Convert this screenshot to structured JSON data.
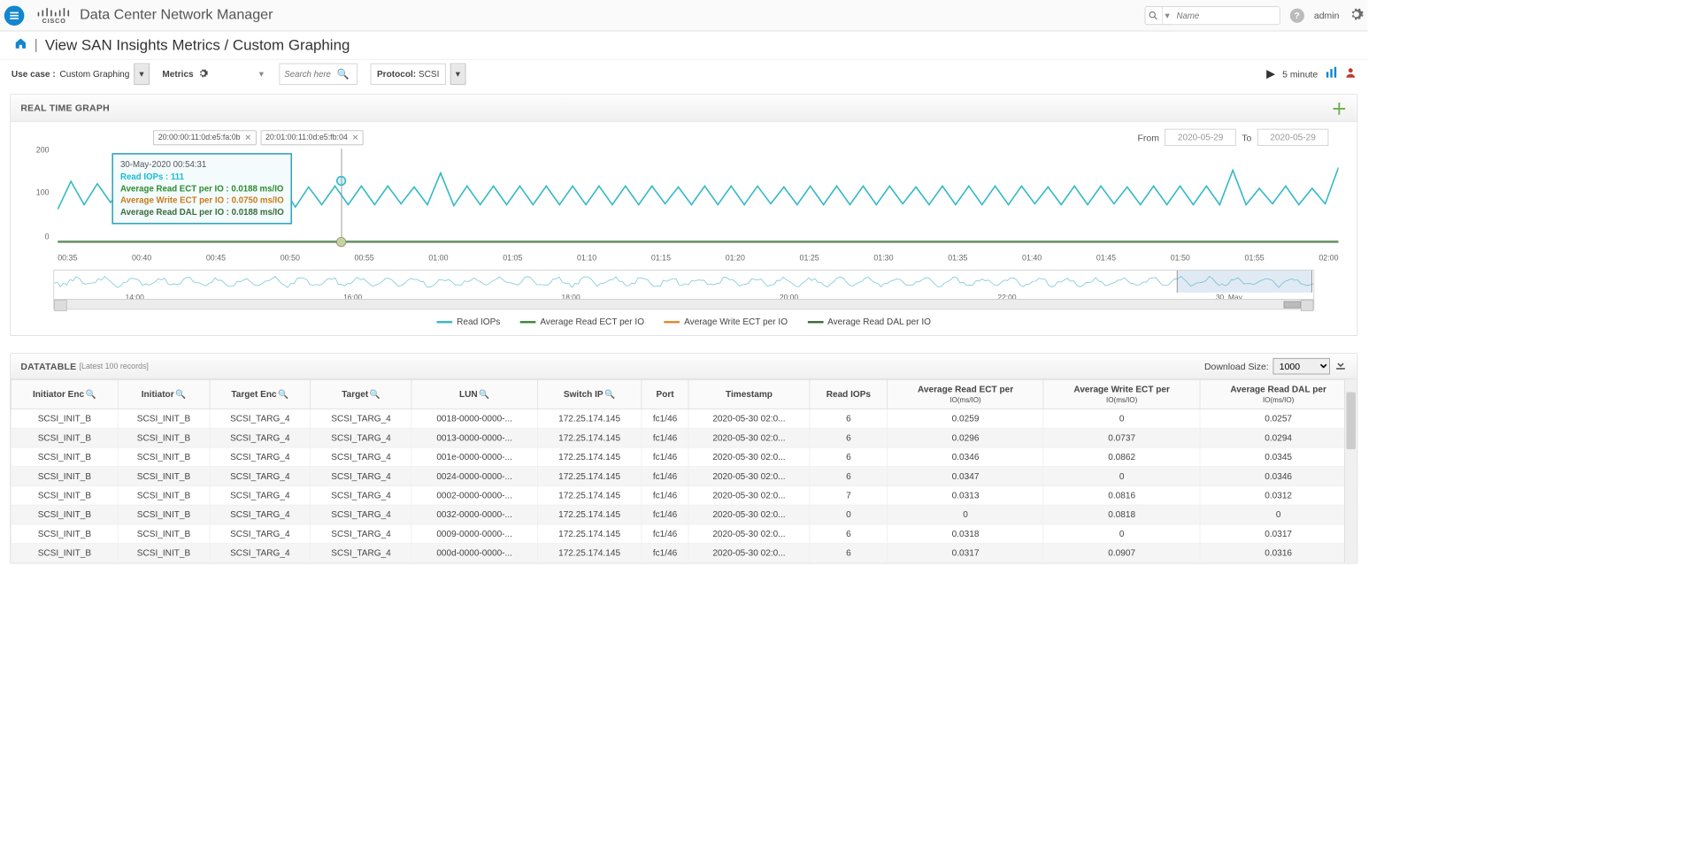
{
  "app_title": "Data Center Network Manager",
  "header": {
    "search_placeholder": "Name",
    "user": "admin"
  },
  "breadcrumb": {
    "path": "View SAN Insights Metrics / Custom Graphing"
  },
  "toolbar": {
    "usecase_label": "Use case :",
    "usecase_value": "Custom Graphing",
    "metrics_label": "Metrics",
    "search_placeholder": "Search here",
    "protocol_label": "Protocol:",
    "protocol_value": "SCSI",
    "refresh": "5 minute"
  },
  "graph_panel": {
    "title": "REAL TIME GRAPH",
    "chips": [
      "20:00:00:11:0d:e5:fa:0b",
      "20:01:00:11:0d:e5:fb:04"
    ],
    "from_label": "From",
    "to_label": "To",
    "from_date": "2020-05-29",
    "to_date": "2020-05-29",
    "tooltip": {
      "time": "30-May-2020 00:54:31",
      "l1_label": "Read IOPs :",
      "l1_val": "111",
      "l2_label": "Average Read ECT per IO :",
      "l2_val": "0.0188 ms/IO",
      "l3_label": "Average Write ECT per IO :",
      "l3_val": "0.0750 ms/IO",
      "l4_label": "Average Read DAL per IO :",
      "l4_val": "0.0188 ms/IO"
    },
    "legend": [
      "Read IOPs",
      "Average Read ECT per IO",
      "Average Write ECT per IO",
      "Average Read DAL per IO"
    ],
    "legend_colors": [
      "#35b9c7",
      "#3a8a3a",
      "#e08a2a",
      "#3a6b3a"
    ]
  },
  "chart_data": {
    "type": "line",
    "title": "REAL TIME GRAPH",
    "xlabel": "",
    "ylabel": "",
    "ylim": [
      0,
      200
    ],
    "y_ticks": [
      0,
      100,
      200
    ],
    "x_ticks": [
      "00:35",
      "00:40",
      "00:45",
      "00:50",
      "00:55",
      "01:00",
      "01:05",
      "01:10",
      "01:15",
      "01:20",
      "01:25",
      "01:30",
      "01:35",
      "01:40",
      "01:45",
      "01:50",
      "01:55",
      "02:00"
    ],
    "series": [
      {
        "name": "Read IOPs",
        "color": "#35b9c7",
        "values": [
          70,
          130,
          80,
          125,
          85,
          120,
          80,
          125,
          75,
          120,
          80,
          125,
          75,
          115,
          78,
          118,
          80,
          120,
          75,
          118,
          80,
          120,
          80,
          120,
          80,
          120,
          82,
          118,
          80,
          148,
          78,
          120,
          80,
          120,
          80,
          120,
          80,
          120,
          80,
          120,
          80,
          120,
          80,
          120,
          80,
          120,
          82,
          118,
          80,
          120,
          80,
          120,
          80,
          120,
          82,
          118,
          80,
          120,
          80,
          120,
          80,
          120,
          80,
          120,
          82,
          118,
          80,
          120,
          80,
          120,
          80,
          120,
          80,
          120,
          82,
          118,
          80,
          120,
          80,
          120,
          82,
          118,
          80,
          120,
          80,
          120,
          80,
          120,
          80,
          154,
          80,
          115,
          82,
          120,
          80,
          115,
          82,
          160
        ]
      },
      {
        "name": "Average Read ECT per IO",
        "color": "#3a8a3a",
        "values": [
          0.019,
          0.018,
          0.02,
          0.019,
          0.018,
          0.019
        ]
      },
      {
        "name": "Average Write ECT per IO",
        "color": "#e08a2a",
        "values": [
          0.075,
          0.07,
          0.08,
          0.076,
          0.074,
          0.078
        ]
      },
      {
        "name": "Average Read DAL per IO",
        "color": "#3a6b3a",
        "values": [
          0.019,
          0.018,
          0.02,
          0.019,
          0.018,
          0.019
        ]
      }
    ],
    "navigator_x_ticks": [
      "14:00",
      "16:00",
      "18:00",
      "20:00",
      "22:00",
      "30. May"
    ]
  },
  "datatable": {
    "title": "DATATABLE",
    "subtitle": "[Latest 100 records]",
    "download_label": "Download Size:",
    "download_value": "1000",
    "columns": [
      "Initiator Enc",
      "Initiator",
      "Target Enc",
      "Target",
      "LUN",
      "Switch IP",
      "Port",
      "Timestamp",
      "Read IOPs",
      "Average Read ECT per IO(ms/IO)",
      "Average Write ECT per IO(ms/IO)",
      "Average Read DAL per IO(ms/IO)"
    ],
    "col_top": [
      "Initiator Enc",
      "Initiator",
      "Target Enc",
      "Target",
      "LUN",
      "Switch IP",
      "Port",
      "Timestamp",
      "Read IOPs",
      "Average Read ECT per",
      "Average Write ECT per",
      "Average Read DAL per"
    ],
    "col_sub": [
      "",
      "",
      "",
      "",
      "",
      "",
      "",
      "",
      "",
      "IO(ms/IO)",
      "IO(ms/IO)",
      "IO(ms/IO)"
    ],
    "rows": [
      [
        "SCSI_INIT_B",
        "SCSI_INIT_B",
        "SCSI_TARG_4",
        "SCSI_TARG_4",
        "0018-0000-0000-...",
        "172.25.174.145",
        "fc1/46",
        "2020-05-30 02:0...",
        "6",
        "0.0259",
        "0",
        "0.0257"
      ],
      [
        "SCSI_INIT_B",
        "SCSI_INIT_B",
        "SCSI_TARG_4",
        "SCSI_TARG_4",
        "0013-0000-0000-...",
        "172.25.174.145",
        "fc1/46",
        "2020-05-30 02:0...",
        "6",
        "0.0296",
        "0.0737",
        "0.0294"
      ],
      [
        "SCSI_INIT_B",
        "SCSI_INIT_B",
        "SCSI_TARG_4",
        "SCSI_TARG_4",
        "001e-0000-0000-...",
        "172.25.174.145",
        "fc1/46",
        "2020-05-30 02:0...",
        "6",
        "0.0346",
        "0.0862",
        "0.0345"
      ],
      [
        "SCSI_INIT_B",
        "SCSI_INIT_B",
        "SCSI_TARG_4",
        "SCSI_TARG_4",
        "0024-0000-0000-...",
        "172.25.174.145",
        "fc1/46",
        "2020-05-30 02:0...",
        "6",
        "0.0347",
        "0",
        "0.0346"
      ],
      [
        "SCSI_INIT_B",
        "SCSI_INIT_B",
        "SCSI_TARG_4",
        "SCSI_TARG_4",
        "0002-0000-0000-...",
        "172.25.174.145",
        "fc1/46",
        "2020-05-30 02:0...",
        "7",
        "0.0313",
        "0.0816",
        "0.0312"
      ],
      [
        "SCSI_INIT_B",
        "SCSI_INIT_B",
        "SCSI_TARG_4",
        "SCSI_TARG_4",
        "0032-0000-0000-...",
        "172.25.174.145",
        "fc1/46",
        "2020-05-30 02:0...",
        "0",
        "0",
        "0.0818",
        "0"
      ],
      [
        "SCSI_INIT_B",
        "SCSI_INIT_B",
        "SCSI_TARG_4",
        "SCSI_TARG_4",
        "0009-0000-0000-...",
        "172.25.174.145",
        "fc1/46",
        "2020-05-30 02:0...",
        "6",
        "0.0318",
        "0",
        "0.0317"
      ],
      [
        "SCSI_INIT_B",
        "SCSI_INIT_B",
        "SCSI_TARG_4",
        "SCSI_TARG_4",
        "000d-0000-0000-...",
        "172.25.174.145",
        "fc1/46",
        "2020-05-30 02:0...",
        "6",
        "0.0317",
        "0.0907",
        "0.0316"
      ]
    ]
  }
}
